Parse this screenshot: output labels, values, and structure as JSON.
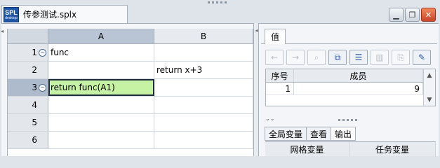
{
  "document": {
    "tab_title": "传参测试.splx",
    "logo_text": "SPL",
    "logo_subtext": "desktop"
  },
  "window_buttons": [
    "minimize",
    "restore",
    "close"
  ],
  "grid": {
    "columns": [
      "A",
      "B"
    ],
    "rows": [
      {
        "num": "1",
        "collapse": true,
        "A": "func",
        "B": ""
      },
      {
        "num": "2",
        "collapse": false,
        "A": "",
        "B": "return  x+3"
      },
      {
        "num": "3",
        "collapse": true,
        "A": "return func(A1)",
        "B": "",
        "selected": true
      },
      {
        "num": "4",
        "collapse": false,
        "A": "",
        "B": ""
      },
      {
        "num": "5",
        "collapse": false,
        "A": "",
        "B": ""
      },
      {
        "num": "6",
        "collapse": false,
        "A": "",
        "B": ""
      }
    ]
  },
  "value_panel": {
    "tab_label": "值",
    "table_headers": [
      "序号",
      "成员"
    ],
    "table_rows": [
      {
        "index": "1",
        "member": "9"
      }
    ],
    "toolbar_icons": [
      "undo-icon",
      "redo-icon",
      "search-icon",
      "copy-icon",
      "table-view-icon",
      "chart-icon",
      "export-icon",
      "pin-icon"
    ]
  },
  "bottom_tabs": [
    "全局变量",
    "查看",
    "输出"
  ],
  "var_grid_headers": [
    "网格变量",
    "任务变量"
  ]
}
